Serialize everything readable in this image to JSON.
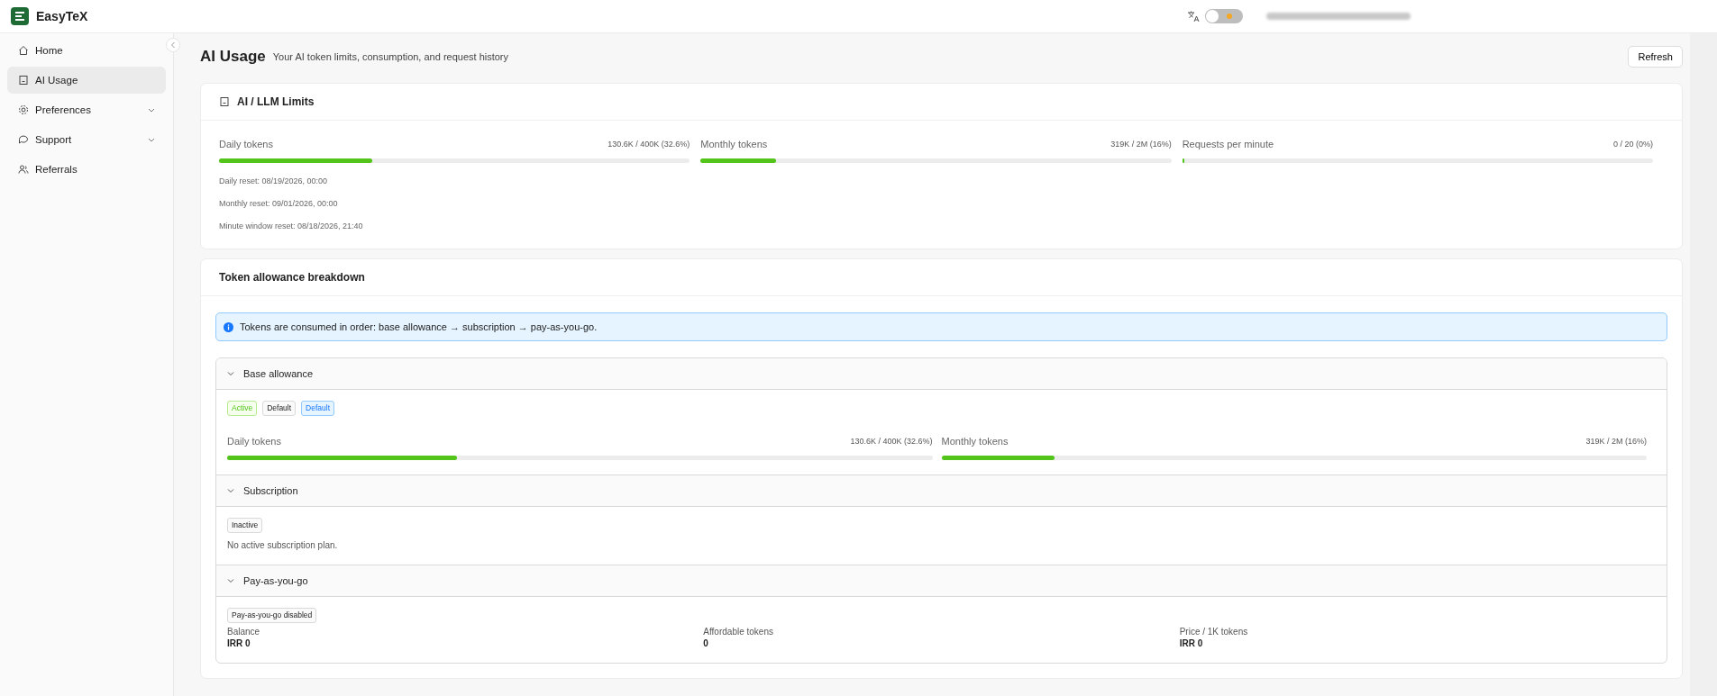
{
  "app": {
    "name": "EasyTeX"
  },
  "topbar": {
    "theme_toggle": {
      "on": false
    }
  },
  "sidebar": {
    "items": [
      {
        "label": "Home",
        "selected": false,
        "has_submenu": false
      },
      {
        "label": "AI Usage",
        "selected": true,
        "has_submenu": false
      },
      {
        "label": "Preferences",
        "selected": false,
        "has_submenu": true
      },
      {
        "label": "Support",
        "selected": false,
        "has_submenu": true
      },
      {
        "label": "Referrals",
        "selected": false,
        "has_submenu": false
      }
    ]
  },
  "page": {
    "title": "AI Usage",
    "subtitle": "Your AI token limits, consumption, and request history",
    "refresh_button": "Refresh"
  },
  "limits": {
    "title": "AI / LLM Limits",
    "meters": [
      {
        "label": "Daily tokens",
        "reading": "130.6K / 400K (32.6%)",
        "level": 0.326
      },
      {
        "label": "Monthly tokens",
        "reading": "319K / 2M (16%)",
        "level": 0.16
      },
      {
        "label": "Requests per minute",
        "reading": "0 / 20 (0%)",
        "level": 0
      }
    ],
    "resets": [
      "Daily reset: 08/19/2026, 00:00",
      "Monthly reset: 09/01/2026, 00:00",
      "Minute window reset: 08/18/2026, 21:40"
    ]
  },
  "breakdown": {
    "title": "Token allowance breakdown",
    "info": "Tokens are consumed in order: base allowance → subscription → pay-as-you-go.",
    "sections": [
      {
        "title": "Base allowance",
        "expanded": true,
        "kind": "meters",
        "tags": [
          {
            "label": "Active",
            "kind": "success"
          },
          {
            "label": "Default",
            "kind": "plain"
          },
          {
            "label": "Default",
            "kind": "info"
          }
        ],
        "meters": [
          {
            "label": "Daily tokens",
            "reading": "130.6K / 400K (32.6%)",
            "level": 0.326
          },
          {
            "label": "Monthly tokens",
            "reading": "319K / 2M (16%)",
            "level": 0.16
          }
        ]
      },
      {
        "title": "Subscription",
        "expanded": true,
        "kind": "message",
        "tags": [
          {
            "label": "Inactive",
            "kind": "plain"
          }
        ],
        "message": "No active subscription plan."
      },
      {
        "title": "Pay-as-you-go",
        "expanded": true,
        "kind": "stats",
        "tags": [
          {
            "label": "Pay-as-you-go disabled",
            "kind": "plain"
          }
        ],
        "stats": [
          {
            "label": "Balance",
            "value": "IRR 0"
          },
          {
            "label": "Affordable tokens",
            "value": "0"
          },
          {
            "label": "Price / 1K tokens",
            "value": "IRR 0"
          }
        ]
      }
    ]
  }
}
